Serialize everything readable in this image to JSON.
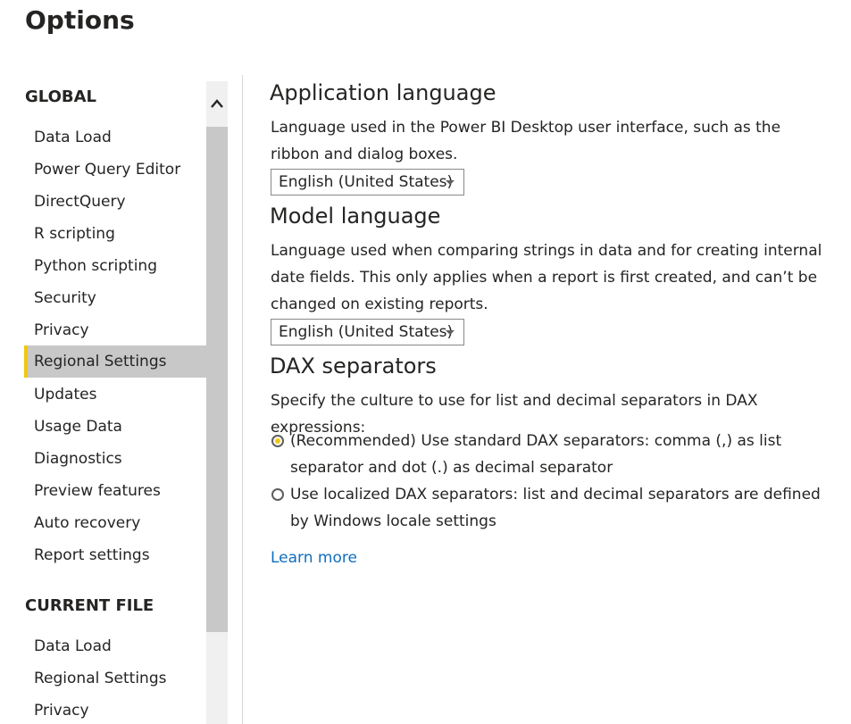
{
  "window": {
    "title": "Options"
  },
  "sidebar": {
    "global_header": "GLOBAL",
    "global_items": [
      {
        "label": "Data Load"
      },
      {
        "label": "Power Query Editor"
      },
      {
        "label": "DirectQuery"
      },
      {
        "label": "R scripting"
      },
      {
        "label": "Python scripting"
      },
      {
        "label": "Security"
      },
      {
        "label": "Privacy"
      },
      {
        "label": "Regional Settings",
        "selected": true
      },
      {
        "label": "Updates"
      },
      {
        "label": "Usage Data"
      },
      {
        "label": "Diagnostics"
      },
      {
        "label": "Preview features"
      },
      {
        "label": "Auto recovery"
      },
      {
        "label": "Report settings"
      }
    ],
    "current_file_header": "CURRENT FILE",
    "current_file_items": [
      {
        "label": "Data Load"
      },
      {
        "label": "Regional Settings"
      },
      {
        "label": "Privacy"
      }
    ]
  },
  "main": {
    "app_language": {
      "heading": "Application language",
      "description": "Language used in the Power BI Desktop user interface, such as the ribbon and dialog boxes.",
      "selected": "English (United States)"
    },
    "model_language": {
      "heading": "Model language",
      "description": "Language used when comparing strings in data and for creating internal date fields. This only applies when a report is first created, and can’t be changed on existing reports.",
      "selected": "English (United States)"
    },
    "dax_separators": {
      "heading": "DAX separators",
      "description": "Specify the culture to use for list and decimal separators in DAX expressions:",
      "options": [
        {
          "label": "(Recommended) Use standard DAX separators: comma (,) as list separator and dot (.) as decimal separator",
          "checked": true
        },
        {
          "label": "Use localized DAX separators: list and decimal separators are defined by Windows locale settings",
          "checked": false
        }
      ],
      "learn_more": "Learn more"
    }
  },
  "colors": {
    "accent_yellow": "#f2c811",
    "selected_bg": "#c8c8c8",
    "link_blue": "#106ebe"
  },
  "icons": {
    "scroll_up": "chevron-up-icon",
    "dropdown": "caret-down-icon"
  }
}
